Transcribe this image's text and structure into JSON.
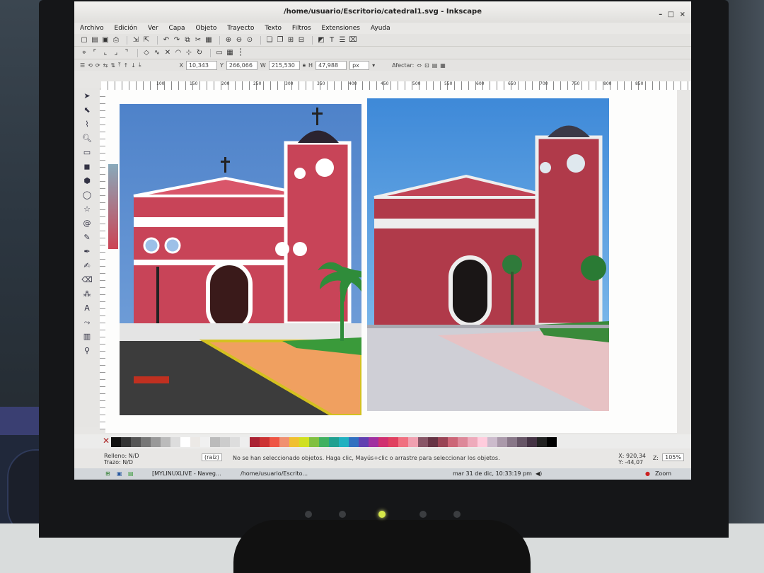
{
  "window": {
    "title": "/home/usuario/Escritorio/catedral1.svg - Inkscape",
    "controls": [
      "–",
      "□",
      "×"
    ]
  },
  "menu": [
    "Archivo",
    "Edición",
    "Ver",
    "Capa",
    "Objeto",
    "Trayecto",
    "Texto",
    "Filtros",
    "Extensiones",
    "Ayuda"
  ],
  "controls": {
    "x": "10,343",
    "y": "266,066",
    "w": "215,530",
    "h": "47,988",
    "unit": "px",
    "affect_label": "Afectar:"
  },
  "ruler_ticks": [
    "100",
    "150",
    "200",
    "250",
    "300",
    "350",
    "400",
    "450",
    "500",
    "550",
    "600",
    "650",
    "700",
    "750",
    "800",
    "850"
  ],
  "status": {
    "fill_label": "Relleno:",
    "fill_value": "N/D",
    "stroke_label": "Trazo:",
    "stroke_value": "N/D",
    "layer": "(raíz)",
    "message": "No se han seleccionado objetos. Haga clic, Mayús+clic o arrastre para seleccionar los objetos.",
    "x": "X: 920,34",
    "y": "Y: -44,07",
    "zoom_label": "Z:",
    "zoom": "105%"
  },
  "taskbar": {
    "task1": "[MYLINUXLIVE - Naveg...",
    "task2": "/home/usuario/Escrito...",
    "clock": "mar 31 de dic, 10:33:19 pm",
    "zoom_app": "Zoom"
  },
  "palette_colors": [
    "#111111",
    "#333333",
    "#555555",
    "#777777",
    "#999999",
    "#bbbbbb",
    "#dddddd",
    "#ffffff",
    "#ece9e6",
    "#f0f0f0",
    "#bbbbbb",
    "#cccccc",
    "#dddddd",
    "#eeeeee",
    "#aa2233",
    "#cc3333",
    "#ee5544",
    "#f09070",
    "#f0c030",
    "#d0e020",
    "#80c040",
    "#40b060",
    "#20a090",
    "#20b0c0",
    "#3070c0",
    "#6040b0",
    "#a030a0",
    "#d03070",
    "#e04060",
    "#f07080",
    "#f0a0b0",
    "#885566",
    "#663344",
    "#994455",
    "#cc6677",
    "#dd8899",
    "#eeaabb",
    "#ffccdd",
    "#ccbbcc",
    "#aa99aa",
    "#887788",
    "#665566",
    "#443344",
    "#222222",
    "#000000"
  ]
}
